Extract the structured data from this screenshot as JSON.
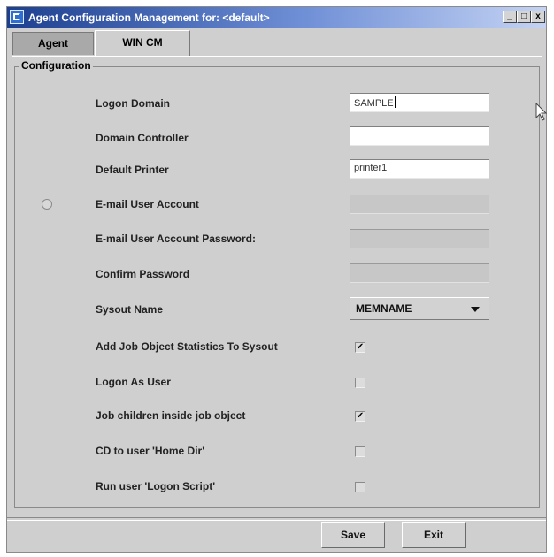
{
  "window": {
    "title": "Agent Configuration Management for: <default>",
    "controls": {
      "minimize": "_",
      "maximize": "□",
      "close": "x"
    }
  },
  "tabs": [
    {
      "label": "Agent",
      "selected": false
    },
    {
      "label": "WIN CM",
      "selected": true
    }
  ],
  "group": {
    "title": "Configuration"
  },
  "fields": {
    "logon_domain": {
      "label": "Logon Domain",
      "value": "SAMPLE"
    },
    "domain_controller": {
      "label": "Domain Controller",
      "value": ""
    },
    "default_printer": {
      "label": "Default Printer",
      "value": "printer1"
    },
    "email_account": {
      "label": "E-mail User Account",
      "value": "",
      "enabled": false,
      "radio_selected": false
    },
    "email_password": {
      "label": "E-mail User Account Password:",
      "value": "",
      "enabled": false
    },
    "confirm_password": {
      "label": "Confirm Password",
      "value": "",
      "enabled": false
    },
    "sysout_name": {
      "label": "Sysout Name",
      "value": "MEMNAME"
    }
  },
  "checkboxes": [
    {
      "label": "Add Job Object Statistics To Sysout",
      "checked": true,
      "mark": "✔"
    },
    {
      "label": "Logon As User",
      "checked": false,
      "mark": ""
    },
    {
      "label": "Job children inside job object",
      "checked": true,
      "mark": "✔"
    },
    {
      "label": "CD to user 'Home Dir'",
      "checked": false,
      "mark": ""
    },
    {
      "label": "Run user 'Logon Script'",
      "checked": false,
      "mark": ""
    }
  ],
  "buttons": {
    "save": "Save",
    "exit": "Exit"
  },
  "icons": {
    "app": "app-icon",
    "cursor": "mouse-pointer-icon",
    "dropdown": "chevron-down-icon"
  }
}
